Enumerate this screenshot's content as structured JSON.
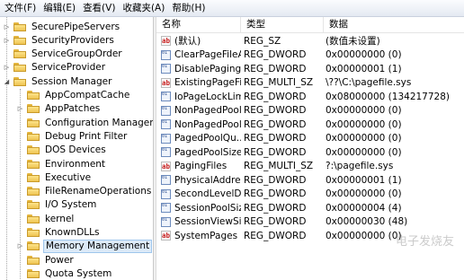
{
  "menu": [
    "文件(F)",
    "编辑(E)",
    "查看(V)",
    "收藏夹(A)",
    "帮助(H)"
  ],
  "tree": [
    {
      "label": "SecurePipeServers",
      "level": 1,
      "expander": "▷"
    },
    {
      "label": "SecurityProviders",
      "level": 1,
      "expander": "▷"
    },
    {
      "label": "ServiceGroupOrder",
      "level": 1,
      "expander": ""
    },
    {
      "label": "ServiceProvider",
      "level": 1,
      "expander": "▷"
    },
    {
      "label": "Session Manager",
      "level": 1,
      "expander": "◢"
    },
    {
      "label": "AppCompatCache",
      "level": 2,
      "expander": ""
    },
    {
      "label": "AppPatches",
      "level": 2,
      "expander": "▷"
    },
    {
      "label": "Configuration Manager",
      "level": 2,
      "expander": ""
    },
    {
      "label": "Debug Print Filter",
      "level": 2,
      "expander": ""
    },
    {
      "label": "DOS Devices",
      "level": 2,
      "expander": ""
    },
    {
      "label": "Environment",
      "level": 2,
      "expander": ""
    },
    {
      "label": "Executive",
      "level": 2,
      "expander": ""
    },
    {
      "label": "FileRenameOperations",
      "level": 2,
      "expander": ""
    },
    {
      "label": "I/O System",
      "level": 2,
      "expander": ""
    },
    {
      "label": "kernel",
      "level": 2,
      "expander": ""
    },
    {
      "label": "KnownDLLs",
      "level": 2,
      "expander": ""
    },
    {
      "label": "Memory Management",
      "level": 2,
      "expander": "▷",
      "selected": true
    },
    {
      "label": "Power",
      "level": 2,
      "expander": ""
    },
    {
      "label": "Quota System",
      "level": 2,
      "expander": ""
    }
  ],
  "columns": {
    "name": "名称",
    "type": "类型",
    "data": "数据"
  },
  "values": [
    {
      "icon": "sz",
      "name": "(默认)",
      "type": "REG_SZ",
      "data": "(数值未设置)"
    },
    {
      "icon": "bin",
      "name": "ClearPageFileA...",
      "type": "REG_DWORD",
      "data": "0x00000000 (0)"
    },
    {
      "icon": "bin",
      "name": "DisablePaging...",
      "type": "REG_DWORD",
      "data": "0x00000001 (1)"
    },
    {
      "icon": "sz",
      "name": "ExistingPageFil...",
      "type": "REG_MULTI_SZ",
      "data": "\\??\\C:\\pagefile.sys"
    },
    {
      "icon": "bin",
      "name": "IoPageLockLimit",
      "type": "REG_DWORD",
      "data": "0x08000000 (134217728)"
    },
    {
      "icon": "bin",
      "name": "NonPagedPool...",
      "type": "REG_DWORD",
      "data": "0x00000000 (0)"
    },
    {
      "icon": "bin",
      "name": "NonPagedPool...",
      "type": "REG_DWORD",
      "data": "0x00000000 (0)"
    },
    {
      "icon": "bin",
      "name": "PagedPoolQu...",
      "type": "REG_DWORD",
      "data": "0x00000000 (0)"
    },
    {
      "icon": "bin",
      "name": "PagedPoolSize",
      "type": "REG_DWORD",
      "data": "0x00000000 (0)"
    },
    {
      "icon": "sz",
      "name": "PagingFiles",
      "type": "REG_MULTI_SZ",
      "data": "?:\\pagefile.sys"
    },
    {
      "icon": "bin",
      "name": "PhysicalAddres...",
      "type": "REG_DWORD",
      "data": "0x00000001 (1)"
    },
    {
      "icon": "bin",
      "name": "SecondLevelD...",
      "type": "REG_DWORD",
      "data": "0x00000000 (0)"
    },
    {
      "icon": "bin",
      "name": "SessionPoolSize",
      "type": "REG_DWORD",
      "data": "0x00000004 (4)"
    },
    {
      "icon": "bin",
      "name": "SessionViewSize",
      "type": "REG_DWORD",
      "data": "0x00000030 (48)"
    },
    {
      "icon": "sz",
      "name": "SystemPages",
      "type": "REG_DWORD",
      "data": "0x00000000 (0)"
    }
  ],
  "watermark": "电子发烧友"
}
